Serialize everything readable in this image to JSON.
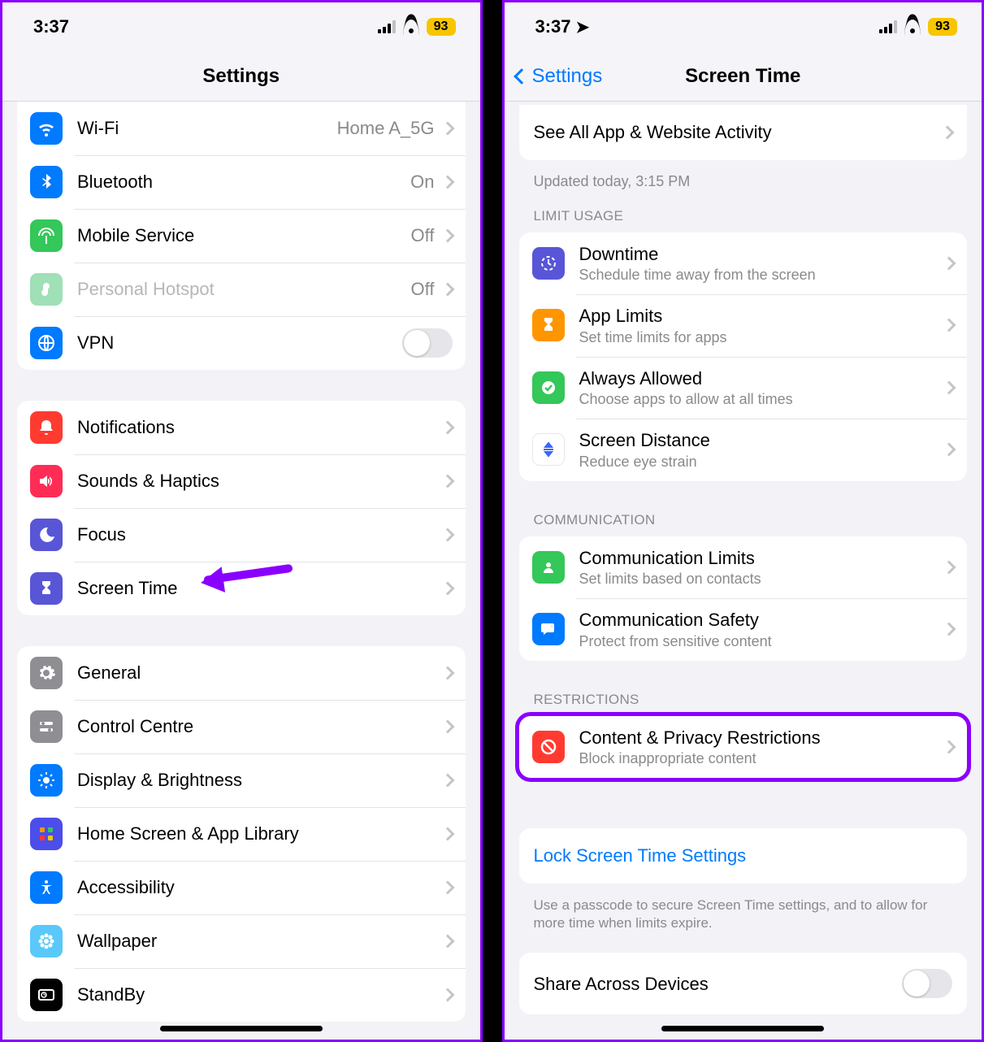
{
  "status": {
    "time": "3:37",
    "battery": "93"
  },
  "left": {
    "title": "Settings",
    "network": {
      "wifi": {
        "label": "Wi-Fi",
        "value": "Home A_5G"
      },
      "bluetooth": {
        "label": "Bluetooth",
        "value": "On"
      },
      "mobile": {
        "label": "Mobile Service",
        "value": "Off"
      },
      "hotspot": {
        "label": "Personal Hotspot",
        "value": "Off"
      },
      "vpn": {
        "label": "VPN"
      }
    },
    "alerts": {
      "notifications": {
        "label": "Notifications"
      },
      "sounds": {
        "label": "Sounds & Haptics"
      },
      "focus": {
        "label": "Focus"
      },
      "screentime": {
        "label": "Screen Time"
      }
    },
    "general_group": {
      "general": {
        "label": "General"
      },
      "control": {
        "label": "Control Centre"
      },
      "display": {
        "label": "Display & Brightness"
      },
      "homescreen": {
        "label": "Home Screen & App Library"
      },
      "accessibility": {
        "label": "Accessibility"
      },
      "wallpaper": {
        "label": "Wallpaper"
      },
      "standby": {
        "label": "StandBy"
      }
    }
  },
  "right": {
    "back": "Settings",
    "title": "Screen Time",
    "activity": {
      "label": "See All App & Website Activity"
    },
    "updated": "Updated today, 3:15 PM",
    "headers": {
      "limit": "LIMIT USAGE",
      "comm": "COMMUNICATION",
      "restrict": "RESTRICTIONS"
    },
    "limit": {
      "downtime": {
        "label": "Downtime",
        "sub": "Schedule time away from the screen"
      },
      "applimits": {
        "label": "App Limits",
        "sub": "Set time limits for apps"
      },
      "always": {
        "label": "Always Allowed",
        "sub": "Choose apps to allow at all times"
      },
      "distance": {
        "label": "Screen Distance",
        "sub": "Reduce eye strain"
      }
    },
    "comm": {
      "limits": {
        "label": "Communication Limits",
        "sub": "Set limits based on contacts"
      },
      "safety": {
        "label": "Communication Safety",
        "sub": "Protect from sensitive content"
      }
    },
    "restrict": {
      "content": {
        "label": "Content & Privacy Restrictions",
        "sub": "Block inappropriate content"
      }
    },
    "lock": {
      "label": "Lock Screen Time Settings"
    },
    "lock_note": "Use a passcode to secure Screen Time settings, and to allow for more time when limits expire.",
    "share": {
      "label": "Share Across Devices"
    }
  },
  "colors": {
    "blue": "#007aff",
    "purple": "#8a00ff",
    "green": "#34c759",
    "red": "#ff3b30",
    "orange": "#ff9500",
    "indigo": "#5856d6",
    "gray": "#8e8e93",
    "pink": "#ff2d55",
    "teal": "#5ac8fa",
    "yellow": "#f7c600"
  }
}
